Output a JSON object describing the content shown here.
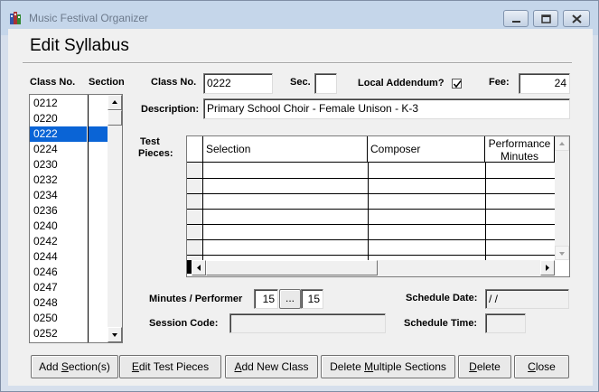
{
  "window": {
    "title": "Music Festival Organizer"
  },
  "heading": "Edit Syllabus",
  "list": {
    "col_class": "Class No.",
    "col_section": "Section",
    "items": [
      "0212",
      "0220",
      "0222",
      "0224",
      "0230",
      "0232",
      "0234",
      "0236",
      "0240",
      "0242",
      "0244",
      "0246",
      "0247",
      "0248",
      "0250",
      "0252"
    ],
    "selected": "0222"
  },
  "form": {
    "class_no_label": "Class No.",
    "class_no_value": "0222",
    "sec_label": "Sec.",
    "sec_value": "",
    "local_addendum_label": "Local Addendum?",
    "local_addendum_checked": true,
    "fee_label": "Fee:",
    "fee_value": "24",
    "description_label": "Description:",
    "description_value": "Primary School Choir - Female Unison - K-3",
    "test_pieces_label_1": "Test",
    "test_pieces_label_2": "Pieces:",
    "grid_headers": {
      "selection": "Selection",
      "composer": "Composer",
      "performance_1": "Performance",
      "performance_2": "Minutes"
    },
    "minutes_label": "Minutes / Performer",
    "minutes_value_1": "15",
    "minutes_ellipsis": "...",
    "minutes_value_2": "15",
    "session_code_label": "Session Code:",
    "session_code_value": "",
    "schedule_date_label": "Schedule Date:",
    "schedule_date_value": " / /",
    "schedule_time_label": "Schedule Time:",
    "schedule_time_value": ""
  },
  "buttons": {
    "add_section": {
      "pre": "Add ",
      "u": "S",
      "post": "ection(s)"
    },
    "edit_test_pieces": {
      "pre": "",
      "u": "E",
      "post": "dit Test Pieces"
    },
    "add_new_class": {
      "pre": "",
      "u": "A",
      "post": "dd New Class"
    },
    "delete_multiple": {
      "pre": "Delete ",
      "u": "M",
      "post": "ultiple Sections"
    },
    "delete": {
      "pre": "",
      "u": "D",
      "post": "elete"
    },
    "close": {
      "pre": "",
      "u": "C",
      "post": "lose"
    }
  }
}
